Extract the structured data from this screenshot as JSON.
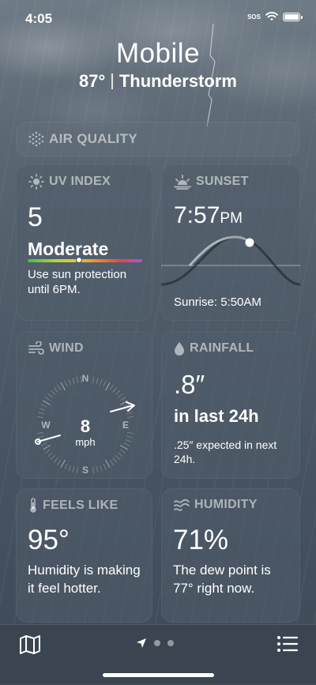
{
  "status": {
    "time": "4:05",
    "sos": "SOS"
  },
  "header": {
    "city": "Mobile",
    "temp": "87°",
    "condition": "Thunderstorm"
  },
  "air_quality": {
    "title": "AIR QUALITY"
  },
  "uv": {
    "title": "UV INDEX",
    "value": "5",
    "level": "Moderate",
    "level_fraction": 0.45,
    "desc": "Use sun protection until 6PM."
  },
  "sunset": {
    "title": "SUNSET",
    "time": "7:57",
    "ampm": "PM",
    "sunrise": "Sunrise: 5:50AM"
  },
  "wind": {
    "title": "WIND",
    "speed": "8",
    "unit": "mph",
    "n": "N",
    "s": "S",
    "e": "E",
    "w": "W"
  },
  "rainfall": {
    "title": "RAINFALL",
    "amount": ".8″",
    "period": "in last 24h",
    "desc": ".25″ expected in next 24h."
  },
  "feels_like": {
    "title": "FEELS LIKE",
    "value": "95°",
    "desc": "Humidity is making it feel hotter."
  },
  "humidity": {
    "title": "HUMIDITY",
    "value": "71%",
    "desc": "The dew point is 77° right now."
  },
  "colors": {
    "background": "#4f5b68",
    "card": "#505c6a",
    "uv_dot": "#ffffff"
  },
  "icons": [
    "air-quality-icon",
    "sun-icon",
    "sunset-icon",
    "wind-icon",
    "raindrop-icon",
    "thermometer-icon",
    "humidity-icon",
    "map-icon",
    "location-arrow-icon",
    "list-icon"
  ]
}
